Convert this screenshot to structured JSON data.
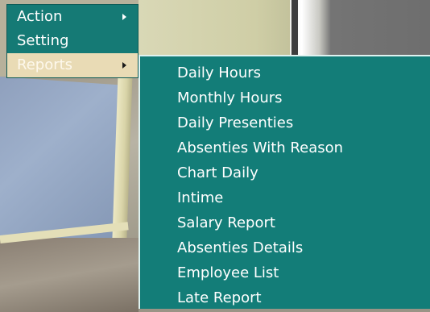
{
  "main_menu": {
    "items": [
      {
        "label": "Action",
        "has_submenu": true
      },
      {
        "label": "Setting",
        "has_submenu": false
      },
      {
        "label": "Reports",
        "has_submenu": true,
        "highlighted": true
      }
    ]
  },
  "reports_submenu": {
    "items": [
      {
        "label": "Daily Hours"
      },
      {
        "label": "Monthly Hours"
      },
      {
        "label": "Daily Presenties"
      },
      {
        "label": "Absenties With Reason"
      },
      {
        "label": "Chart Daily"
      },
      {
        "label": "Intime"
      },
      {
        "label": "Salary Report"
      },
      {
        "label": "Absenties Details"
      },
      {
        "label": "Employee List"
      },
      {
        "label": "Late Report"
      }
    ]
  },
  "colors": {
    "menu_background": "#157a75",
    "highlight_background": "#e9dbb5",
    "text": "#ffffff"
  }
}
